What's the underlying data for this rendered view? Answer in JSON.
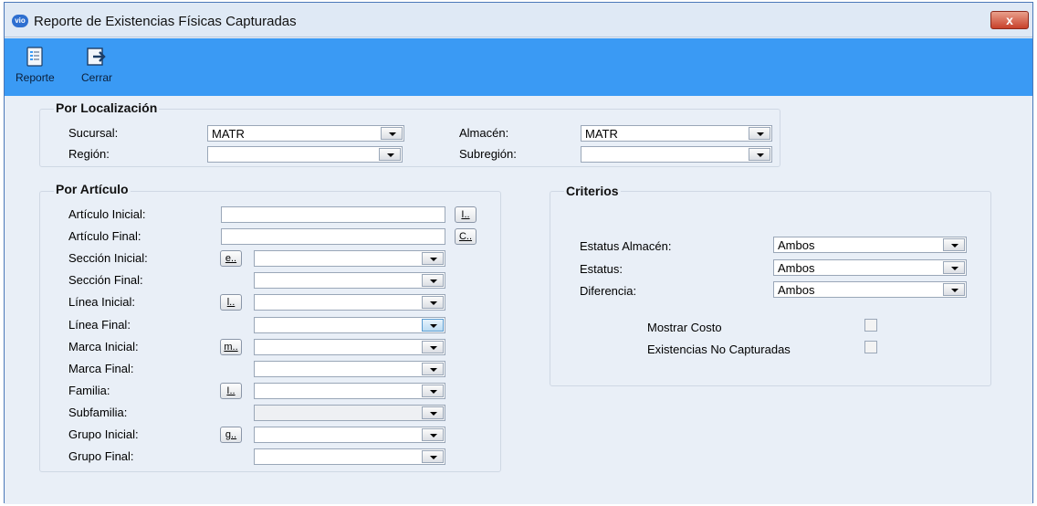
{
  "window": {
    "title": "Reporte de Existencias Físicas Capturadas",
    "app_icon": "vio",
    "close_label": "x"
  },
  "toolbar": {
    "reporte_label": "Reporte",
    "cerrar_label": "Cerrar"
  },
  "localizacion": {
    "title": "Por Localización",
    "sucursal_label": "Sucursal:",
    "sucursal_value": "MATR",
    "region_label": "Región:",
    "region_value": "",
    "almacen_label": "Almacén:",
    "almacen_value": "MATR",
    "subregion_label": "Subregión:",
    "subregion_value": ""
  },
  "articulo": {
    "title": "Por Artículo",
    "rows": [
      {
        "label": "Artículo Inicial:",
        "btn": "I..",
        "value": ""
      },
      {
        "label": "Artículo Final:",
        "btn": "C..",
        "value": ""
      },
      {
        "label": "Sección Inicial:",
        "btn": "e..",
        "value": ""
      },
      {
        "label": "Sección Final:",
        "btn": "",
        "value": ""
      },
      {
        "label": "Línea Inicial:",
        "btn": "l..",
        "value": ""
      },
      {
        "label": "Línea Final:",
        "btn": "",
        "value": ""
      },
      {
        "label": "Marca Inicial:",
        "btn": "m..",
        "value": ""
      },
      {
        "label": "Marca Final:",
        "btn": "",
        "value": ""
      },
      {
        "label": "Familia:",
        "btn": "I..",
        "value": ""
      },
      {
        "label": "Subfamilia:",
        "btn": "",
        "value": ""
      },
      {
        "label": "Grupo Inicial:",
        "btn": "g..",
        "value": ""
      },
      {
        "label": "Grupo Final:",
        "btn": "",
        "value": ""
      }
    ]
  },
  "criterios": {
    "title": "Criterios",
    "estatus_almacen_label": "Estatus Almacén:",
    "estatus_almacen_value": "Ambos",
    "estatus_label": "Estatus:",
    "estatus_value": "Ambos",
    "diferencia_label": "Diferencia:",
    "diferencia_value": "Ambos",
    "mostrar_costo_label": "Mostrar Costo",
    "mostrar_costo_checked": false,
    "no_capturadas_label": "Existencias No Capturadas",
    "no_capturadas_checked": false
  },
  "colors": {
    "toolbar": "#3a9af4",
    "titlebar": "#dfe9f5",
    "panel": "#e9eff7",
    "close": "#c8412a"
  }
}
